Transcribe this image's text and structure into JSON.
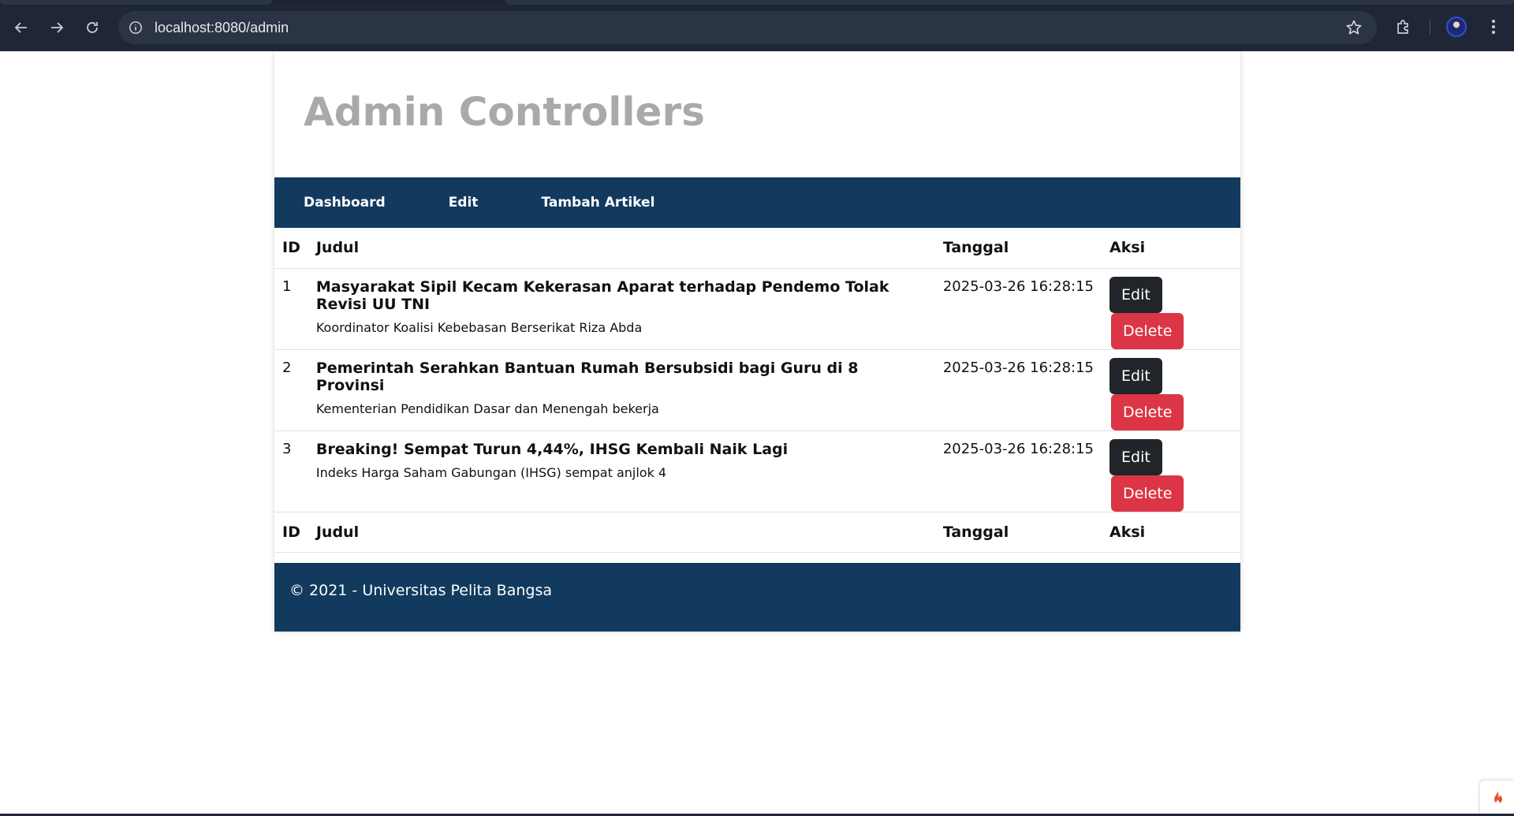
{
  "browser": {
    "url": "localhost:8080/admin"
  },
  "page": {
    "title": "Admin Controllers"
  },
  "nav": {
    "items": [
      "Dashboard",
      "Edit",
      "Tambah Artikel"
    ]
  },
  "table": {
    "headers": {
      "id": "ID",
      "judul": "Judul",
      "tanggal": "Tanggal",
      "aksi": "Aksi"
    },
    "rows": [
      {
        "id": "1",
        "title": "Masyarakat Sipil Kecam Kekerasan Aparat terhadap Pendemo Tolak Revisi UU TNI",
        "excerpt": "Koordinator Koalisi Kebebasan Berserikat Riza Abda",
        "date": "2025-03-26 16:28:15",
        "edit": "Edit",
        "delete": "Delete"
      },
      {
        "id": "2",
        "title": "Pemerintah Serahkan Bantuan Rumah Bersubsidi bagi Guru di 8 Provinsi",
        "excerpt": "Kementerian Pendidikan Dasar dan Menengah bekerja",
        "date": "2025-03-26 16:28:15",
        "edit": "Edit",
        "delete": "Delete"
      },
      {
        "id": "3",
        "title": "Breaking! Sempat Turun 4,44%, IHSG Kembali Naik Lagi",
        "excerpt": "Indeks Harga Saham Gabungan (IHSG) sempat anjlok 4",
        "date": "2025-03-26 16:28:15",
        "edit": "Edit",
        "delete": "Delete"
      }
    ]
  },
  "footer": {
    "text": "© 2021 - Universitas Pelita Bangsa"
  },
  "colors": {
    "navbar": "#123a5f",
    "danger": "#dc3545",
    "dark": "#212529",
    "title": "#a9a9a9"
  }
}
